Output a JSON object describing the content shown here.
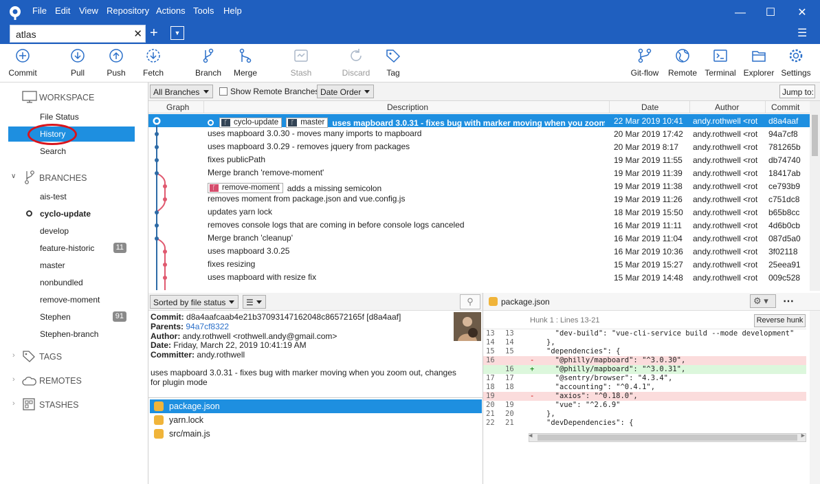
{
  "menu": [
    "File",
    "Edit",
    "View",
    "Repository",
    "Actions",
    "Tools",
    "Help"
  ],
  "tab": {
    "label": "atlas"
  },
  "toolbar": {
    "commit": "Commit",
    "pull": "Pull",
    "push": "Push",
    "fetch": "Fetch",
    "branch": "Branch",
    "merge": "Merge",
    "stash": "Stash",
    "discard": "Discard",
    "tag": "Tag",
    "gitflow": "Git-flow",
    "remote": "Remote",
    "terminal": "Terminal",
    "explorer": "Explorer",
    "settings": "Settings"
  },
  "sidebar": {
    "workspace": "WORKSPACE",
    "file_status": "File Status",
    "history": "History",
    "search": "Search",
    "branches_header": "BRANCHES",
    "branches": [
      {
        "name": "ais-test",
        "count": ""
      },
      {
        "name": "cyclo-update",
        "count": ""
      },
      {
        "name": "develop",
        "count": ""
      },
      {
        "name": "feature-historic",
        "count": "11"
      },
      {
        "name": "master",
        "count": ""
      },
      {
        "name": "nonbundled",
        "count": ""
      },
      {
        "name": "remove-moment",
        "count": ""
      },
      {
        "name": "Stephen",
        "count": "91"
      },
      {
        "name": "Stephen-branch",
        "count": ""
      }
    ],
    "tags": "TAGS",
    "remotes": "REMOTES",
    "stashes": "STASHES"
  },
  "filters": {
    "branches": "All Branches",
    "show_remote": "Show Remote Branches",
    "order": "Date Order",
    "jump": "Jump to:"
  },
  "columns": {
    "graph": "Graph",
    "description": "Description",
    "date": "Date",
    "author": "Author",
    "commit": "Commit"
  },
  "commits": [
    {
      "desc": "uses mapboard 3.0.31 - fixes bug with marker moving when you zoom out, changes for plugin mode",
      "tags": [
        "cyclo-update",
        "master"
      ],
      "date": "22 Mar 2019 10:41",
      "author": "andy.rothwell <rot",
      "hash": "d8a4aaf"
    },
    {
      "desc": "uses mapboard 3.0.30 - moves many imports to mapboard",
      "tags": [],
      "date": "20 Mar 2019 17:42",
      "author": "andy.rothwell <rot",
      "hash": "94a7cf8"
    },
    {
      "desc": "uses mapboard 3.0.29 - removes jquery from packages",
      "tags": [],
      "date": "20 Mar 2019 8:17",
      "author": "andy.rothwell <rot",
      "hash": "781265b"
    },
    {
      "desc": "fixes publicPath",
      "tags": [],
      "date": "19 Mar 2019 11:55",
      "author": "andy.rothwell <rot",
      "hash": "db74740"
    },
    {
      "desc": "Merge branch 'remove-moment'",
      "tags": [],
      "date": "19 Mar 2019 11:39",
      "author": "andy.rothwell <rot",
      "hash": "18417ab"
    },
    {
      "desc": "adds a missing semicolon",
      "tags": [
        "remove-moment"
      ],
      "date": "19 Mar 2019 11:38",
      "author": "andy.rothwell <rot",
      "hash": "ce793b9"
    },
    {
      "desc": "removes moment from package.json and vue.config.js",
      "tags": [],
      "date": "19 Mar 2019 11:26",
      "author": "andy.rothwell <rot",
      "hash": "c751dc8"
    },
    {
      "desc": "updates yarn lock",
      "tags": [],
      "date": "18 Mar 2019 15:50",
      "author": "andy.rothwell <rot",
      "hash": "b65b8cc"
    },
    {
      "desc": "removes console logs that are coming in before console logs canceled",
      "tags": [],
      "date": "16 Mar 2019 11:11",
      "author": "andy.rothwell <rot",
      "hash": "4d6b0cb"
    },
    {
      "desc": "Merge branch 'cleanup'",
      "tags": [],
      "date": "16 Mar 2019 11:04",
      "author": "andy.rothwell <rot",
      "hash": "087d5a0"
    },
    {
      "desc": "uses mapboard 3.0.25",
      "tags": [],
      "date": "16 Mar 2019 10:36",
      "author": "andy.rothwell <rot",
      "hash": "3f02118"
    },
    {
      "desc": "fixes resizing",
      "tags": [],
      "date": "15 Mar 2019 15:27",
      "author": "andy.rothwell <rot",
      "hash": "25eea91"
    },
    {
      "desc": "uses mapboard with resize fix",
      "tags": [],
      "date": "15 Mar 2019 14:48",
      "author": "andy.rothwell <rot",
      "hash": "009c528"
    }
  ],
  "lower": {
    "sort": "Sorted by file status"
  },
  "details": {
    "commit_label": "Commit:",
    "commit": "d8a4aafcaab4e21b37093147162048c86572165f [d8a4aaf]",
    "parents_label": "Parents:",
    "parents": "94a7cf8322",
    "author_label": "Author:",
    "author": "andy.rothwell <rothwell.andy@gmail.com>",
    "date_label": "Date:",
    "date": "Friday, March 22, 2019 10:41:19 AM",
    "committer_label": "Committer:",
    "committer": "andy.rothwell",
    "message1": "uses mapboard 3.0.31 - fixes bug with marker moving when you zoom out, changes",
    "message2": "for plugin mode"
  },
  "files": [
    "package.json",
    "yarn.lock",
    "src/main.js"
  ],
  "diff": {
    "file": "package.json",
    "hunk": "Hunk 1 : Lines 13-21",
    "reverse": "Reverse hunk",
    "lines": [
      {
        "a": "13",
        "b": "13",
        "m": "",
        "t": "  \"dev-build\": \"vue-cli-service build --mode development\"",
        "k": ""
      },
      {
        "a": "14",
        "b": "14",
        "m": "",
        "t": "},",
        "k": ""
      },
      {
        "a": "15",
        "b": "15",
        "m": "",
        "t": "\"dependencies\": {",
        "k": ""
      },
      {
        "a": "16",
        "b": "",
        "m": "-",
        "t": "  \"@philly/mapboard\": \"^3.0.30\",",
        "k": "del"
      },
      {
        "a": "",
        "b": "16",
        "m": "+",
        "t": "  \"@philly/mapboard\": \"^3.0.31\",",
        "k": "add"
      },
      {
        "a": "17",
        "b": "17",
        "m": "",
        "t": "  \"@sentry/browser\": \"4.3.4\",",
        "k": ""
      },
      {
        "a": "18",
        "b": "18",
        "m": "",
        "t": "  \"accounting\": \"^0.4.1\",",
        "k": ""
      },
      {
        "a": "19",
        "b": "",
        "m": "-",
        "t": "  \"axios\": \"^0.18.0\",",
        "k": "del"
      },
      {
        "a": "20",
        "b": "19",
        "m": "",
        "t": "  \"vue\": \"^2.6.9\"",
        "k": ""
      },
      {
        "a": "21",
        "b": "20",
        "m": "",
        "t": "},",
        "k": ""
      },
      {
        "a": "22",
        "b": "21",
        "m": "",
        "t": "\"devDependencies\": {",
        "k": ""
      }
    ]
  }
}
